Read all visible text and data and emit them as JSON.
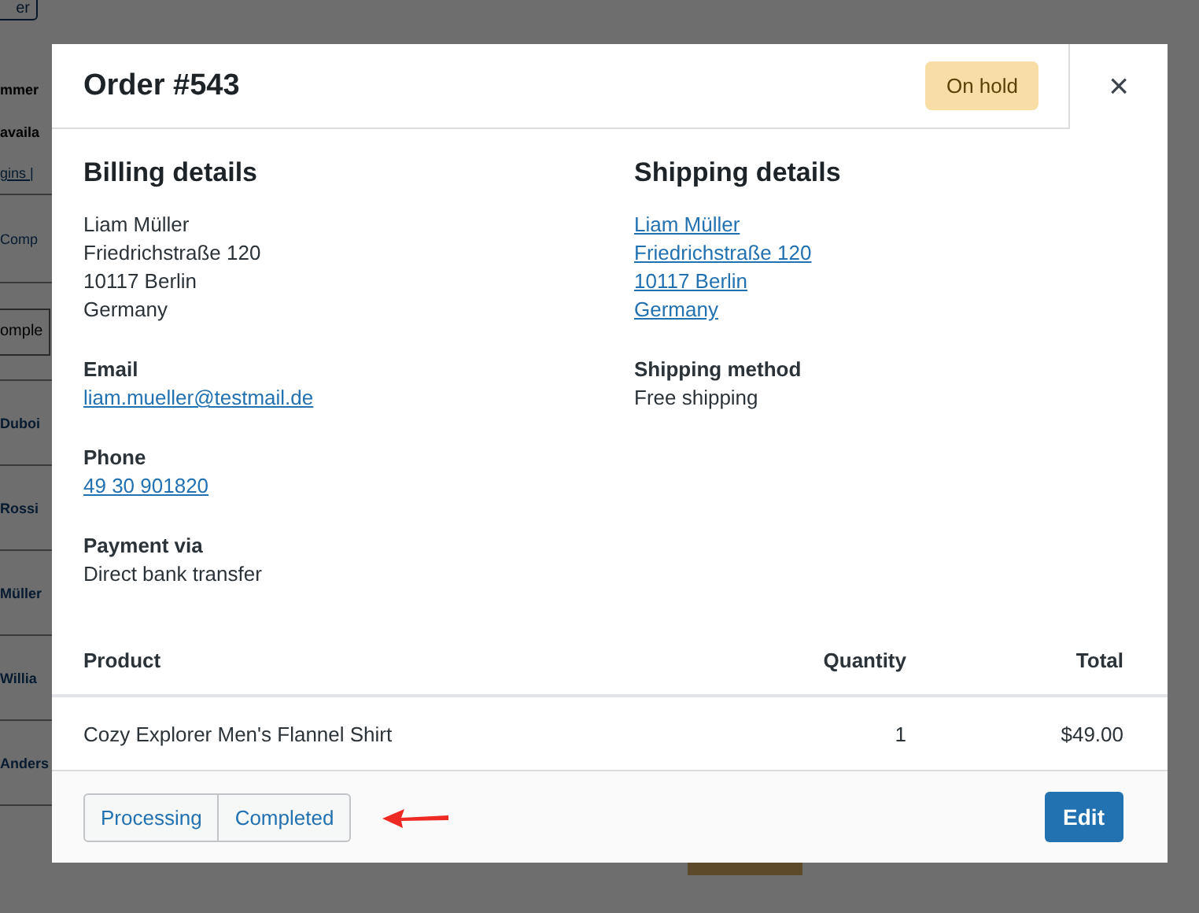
{
  "background": {
    "top_button": "er",
    "lines": [
      {
        "kind": "text",
        "text": "mmer"
      },
      {
        "kind": "text",
        "text": "availa"
      },
      {
        "kind": "link",
        "text": "gins |"
      },
      {
        "kind": "tab",
        "text": "Comp"
      },
      {
        "kind": "select",
        "text": "omple"
      },
      {
        "kind": "name",
        "text": "Duboi"
      },
      {
        "kind": "name",
        "text": "Rossi"
      },
      {
        "kind": "name",
        "text": "Müller"
      },
      {
        "kind": "name",
        "text": "Willia"
      },
      {
        "kind": "name",
        "text": "Anders"
      }
    ]
  },
  "modal": {
    "title": "Order #543",
    "status": "On hold",
    "close": "×",
    "billing": {
      "heading": "Billing details",
      "address": {
        "linked": false,
        "lines": [
          "Liam Müller",
          "Friedrichstraße 120",
          "10117 Berlin",
          "Germany"
        ]
      },
      "fields": [
        {
          "label": "Email",
          "value": "liam.mueller@testmail.de",
          "kind": "link"
        },
        {
          "label": "Phone",
          "value": "49 30 901820",
          "kind": "link"
        },
        {
          "label": "Payment via",
          "value": "Direct bank transfer",
          "kind": "text"
        }
      ]
    },
    "shipping": {
      "heading": "Shipping details",
      "address": {
        "linked": true,
        "lines": [
          "Liam Müller",
          "Friedrichstraße 120",
          "10117 Berlin",
          "Germany"
        ]
      },
      "fields": [
        {
          "label": "Shipping method",
          "value": "Free shipping",
          "kind": "text"
        }
      ]
    },
    "table": {
      "columns": [
        "Product",
        "Quantity",
        "Total"
      ],
      "rows": [
        [
          "Cozy Explorer Men's Flannel Shirt",
          "1",
          "$49.00"
        ]
      ]
    },
    "footer": {
      "status_buttons": [
        "Processing",
        "Completed"
      ],
      "edit": "Edit"
    }
  }
}
